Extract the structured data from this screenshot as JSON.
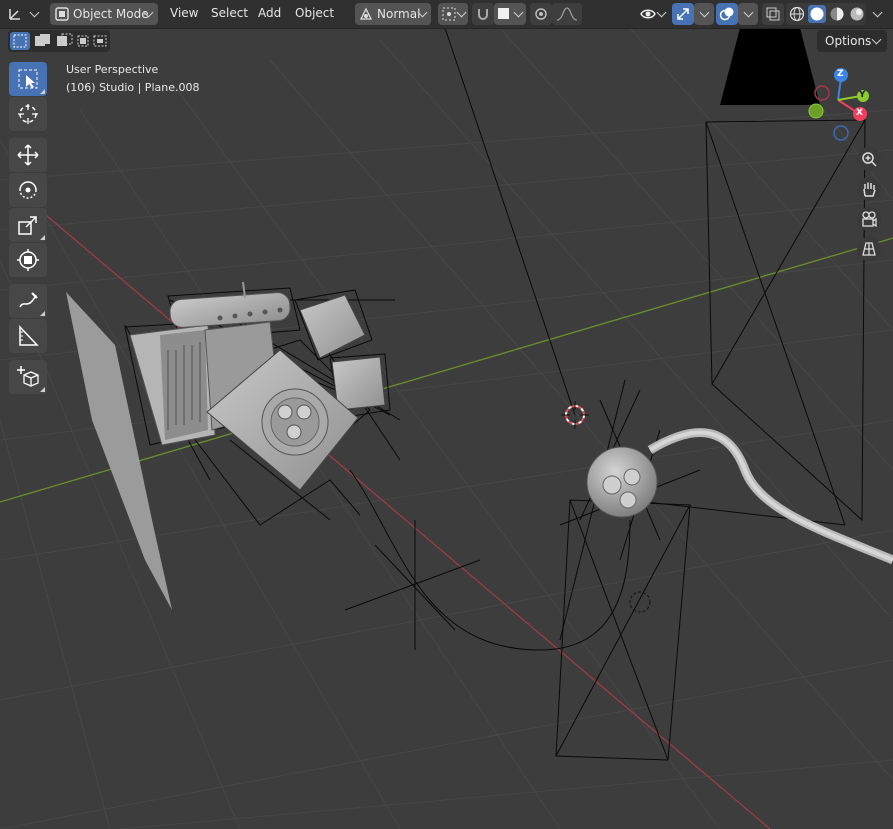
{
  "header": {
    "mode_label": "Object Mode",
    "menus": [
      "View",
      "Select",
      "Add",
      "Object"
    ],
    "orientation_label": "Normal",
    "options_label": "Options"
  },
  "viewport": {
    "view_name": "User Perspective",
    "object_info": "(106) Studio | Plane.008"
  },
  "gizmo": {
    "z_label": "Z",
    "y_label": "Y",
    "x_label": "X"
  },
  "icons": {
    "editor_type": "axes-icon",
    "mode": "object-mode-icon",
    "transform_orientation": "orientation-icon",
    "pivot": "pivot-icon",
    "snap": "magnet-icon",
    "proportional": "proportional-edit-icon",
    "visibility": "eye-icon",
    "gizmos": "gizmo-icon",
    "overlays": "overlay-icon",
    "xray": "xray-icon",
    "shading": [
      "wireframe-icon",
      "solid-icon",
      "material-icon",
      "rendered-icon"
    ],
    "tools": [
      "select-box-icon",
      "cursor-icon",
      "move-icon",
      "rotate-icon",
      "scale-icon",
      "transform-icon",
      "annotate-icon",
      "measure-icon",
      "add-cube-icon"
    ],
    "nav": [
      "zoom-icon",
      "hand-icon",
      "camera-icon",
      "grid-view-icon"
    ]
  },
  "colors": {
    "accent": "#4772b3",
    "x_axis": "#f33e5d",
    "y_axis": "#8bcc2e",
    "z_axis": "#3a85e6"
  }
}
